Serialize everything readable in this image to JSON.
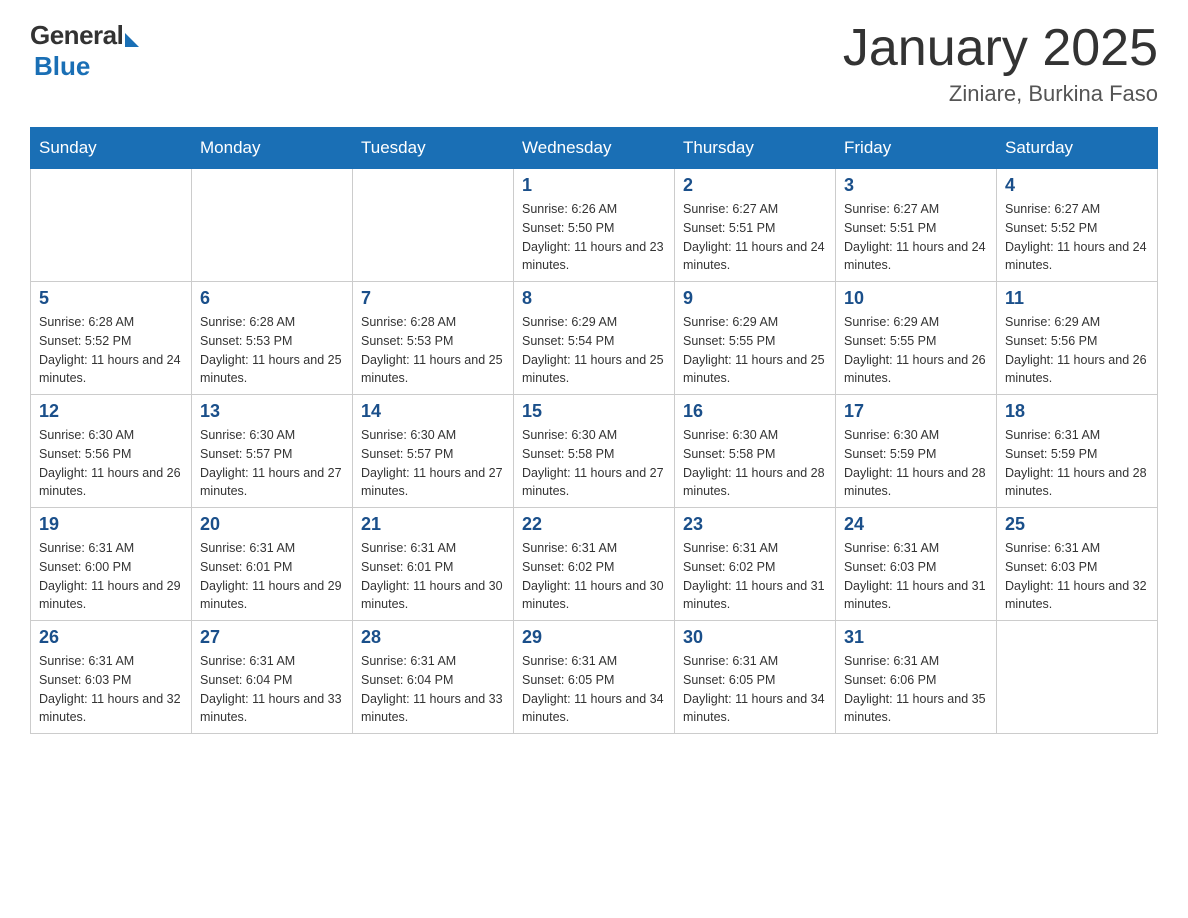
{
  "header": {
    "logo_general": "General",
    "logo_blue": "Blue",
    "month_title": "January 2025",
    "location": "Ziniare, Burkina Faso"
  },
  "days_of_week": [
    "Sunday",
    "Monday",
    "Tuesday",
    "Wednesday",
    "Thursday",
    "Friday",
    "Saturday"
  ],
  "weeks": [
    [
      {
        "day": "",
        "info": ""
      },
      {
        "day": "",
        "info": ""
      },
      {
        "day": "",
        "info": ""
      },
      {
        "day": "1",
        "info": "Sunrise: 6:26 AM\nSunset: 5:50 PM\nDaylight: 11 hours and 23 minutes."
      },
      {
        "day": "2",
        "info": "Sunrise: 6:27 AM\nSunset: 5:51 PM\nDaylight: 11 hours and 24 minutes."
      },
      {
        "day": "3",
        "info": "Sunrise: 6:27 AM\nSunset: 5:51 PM\nDaylight: 11 hours and 24 minutes."
      },
      {
        "day": "4",
        "info": "Sunrise: 6:27 AM\nSunset: 5:52 PM\nDaylight: 11 hours and 24 minutes."
      }
    ],
    [
      {
        "day": "5",
        "info": "Sunrise: 6:28 AM\nSunset: 5:52 PM\nDaylight: 11 hours and 24 minutes."
      },
      {
        "day": "6",
        "info": "Sunrise: 6:28 AM\nSunset: 5:53 PM\nDaylight: 11 hours and 25 minutes."
      },
      {
        "day": "7",
        "info": "Sunrise: 6:28 AM\nSunset: 5:53 PM\nDaylight: 11 hours and 25 minutes."
      },
      {
        "day": "8",
        "info": "Sunrise: 6:29 AM\nSunset: 5:54 PM\nDaylight: 11 hours and 25 minutes."
      },
      {
        "day": "9",
        "info": "Sunrise: 6:29 AM\nSunset: 5:55 PM\nDaylight: 11 hours and 25 minutes."
      },
      {
        "day": "10",
        "info": "Sunrise: 6:29 AM\nSunset: 5:55 PM\nDaylight: 11 hours and 26 minutes."
      },
      {
        "day": "11",
        "info": "Sunrise: 6:29 AM\nSunset: 5:56 PM\nDaylight: 11 hours and 26 minutes."
      }
    ],
    [
      {
        "day": "12",
        "info": "Sunrise: 6:30 AM\nSunset: 5:56 PM\nDaylight: 11 hours and 26 minutes."
      },
      {
        "day": "13",
        "info": "Sunrise: 6:30 AM\nSunset: 5:57 PM\nDaylight: 11 hours and 27 minutes."
      },
      {
        "day": "14",
        "info": "Sunrise: 6:30 AM\nSunset: 5:57 PM\nDaylight: 11 hours and 27 minutes."
      },
      {
        "day": "15",
        "info": "Sunrise: 6:30 AM\nSunset: 5:58 PM\nDaylight: 11 hours and 27 minutes."
      },
      {
        "day": "16",
        "info": "Sunrise: 6:30 AM\nSunset: 5:58 PM\nDaylight: 11 hours and 28 minutes."
      },
      {
        "day": "17",
        "info": "Sunrise: 6:30 AM\nSunset: 5:59 PM\nDaylight: 11 hours and 28 minutes."
      },
      {
        "day": "18",
        "info": "Sunrise: 6:31 AM\nSunset: 5:59 PM\nDaylight: 11 hours and 28 minutes."
      }
    ],
    [
      {
        "day": "19",
        "info": "Sunrise: 6:31 AM\nSunset: 6:00 PM\nDaylight: 11 hours and 29 minutes."
      },
      {
        "day": "20",
        "info": "Sunrise: 6:31 AM\nSunset: 6:01 PM\nDaylight: 11 hours and 29 minutes."
      },
      {
        "day": "21",
        "info": "Sunrise: 6:31 AM\nSunset: 6:01 PM\nDaylight: 11 hours and 30 minutes."
      },
      {
        "day": "22",
        "info": "Sunrise: 6:31 AM\nSunset: 6:02 PM\nDaylight: 11 hours and 30 minutes."
      },
      {
        "day": "23",
        "info": "Sunrise: 6:31 AM\nSunset: 6:02 PM\nDaylight: 11 hours and 31 minutes."
      },
      {
        "day": "24",
        "info": "Sunrise: 6:31 AM\nSunset: 6:03 PM\nDaylight: 11 hours and 31 minutes."
      },
      {
        "day": "25",
        "info": "Sunrise: 6:31 AM\nSunset: 6:03 PM\nDaylight: 11 hours and 32 minutes."
      }
    ],
    [
      {
        "day": "26",
        "info": "Sunrise: 6:31 AM\nSunset: 6:03 PM\nDaylight: 11 hours and 32 minutes."
      },
      {
        "day": "27",
        "info": "Sunrise: 6:31 AM\nSunset: 6:04 PM\nDaylight: 11 hours and 33 minutes."
      },
      {
        "day": "28",
        "info": "Sunrise: 6:31 AM\nSunset: 6:04 PM\nDaylight: 11 hours and 33 minutes."
      },
      {
        "day": "29",
        "info": "Sunrise: 6:31 AM\nSunset: 6:05 PM\nDaylight: 11 hours and 34 minutes."
      },
      {
        "day": "30",
        "info": "Sunrise: 6:31 AM\nSunset: 6:05 PM\nDaylight: 11 hours and 34 minutes."
      },
      {
        "day": "31",
        "info": "Sunrise: 6:31 AM\nSunset: 6:06 PM\nDaylight: 11 hours and 35 minutes."
      },
      {
        "day": "",
        "info": ""
      }
    ]
  ]
}
